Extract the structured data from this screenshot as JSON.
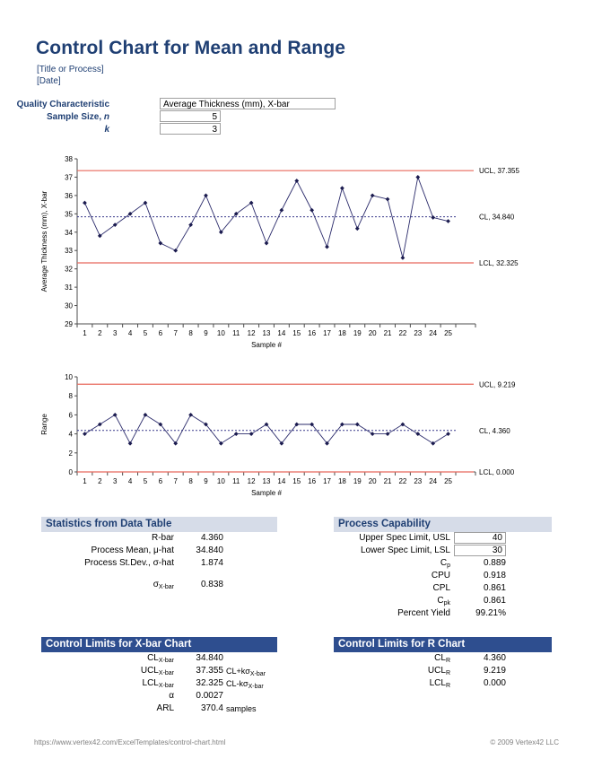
{
  "header": {
    "title": "Control Chart for Mean and Range",
    "subtitle_process": "[Title or Process]",
    "subtitle_date": "[Date]",
    "accent_color": "#1F3F73"
  },
  "inputs": {
    "quality_characteristic_label": "Quality Characteristic",
    "quality_characteristic_value": "Average Thickness (mm), X-bar",
    "sample_size_label": "Sample Size, n",
    "sample_size_value": "5",
    "k_label": "k",
    "k_value": "3"
  },
  "chart_data": [
    {
      "type": "line",
      "name": "xbar-chart",
      "title": "",
      "xlabel": "Sample #",
      "ylabel": "Average Thickness (mm), X-bar",
      "categories": [
        1,
        2,
        3,
        4,
        5,
        6,
        7,
        8,
        9,
        10,
        11,
        12,
        13,
        14,
        15,
        16,
        17,
        18,
        19,
        20,
        21,
        22,
        23,
        24,
        25
      ],
      "values": [
        35.6,
        33.8,
        34.4,
        35.0,
        35.6,
        33.4,
        33.0,
        34.4,
        36.0,
        34.0,
        35.0,
        35.6,
        33.4,
        35.2,
        36.8,
        35.2,
        33.2,
        36.4,
        34.2,
        36.0,
        35.8,
        32.6,
        37.0,
        34.8,
        34.6
      ],
      "ylim": [
        29,
        38
      ],
      "ytick_step": 1,
      "yticks": [
        29,
        30,
        31,
        32,
        33,
        34,
        35,
        36,
        37,
        38
      ],
      "grid": false,
      "legend": "none",
      "reference_lines": [
        {
          "key": "UCL",
          "label": "UCL, 37.355",
          "value": 37.355,
          "color": "#E8685C",
          "style": "solid"
        },
        {
          "key": "CL",
          "label": "CL, 34.840",
          "value": 34.84,
          "color": "#3A3A8C",
          "style": "dashed"
        },
        {
          "key": "LCL",
          "label": "LCL, 32.325",
          "value": 32.325,
          "color": "#E8685C",
          "style": "solid"
        }
      ]
    },
    {
      "type": "line",
      "name": "r-chart",
      "title": "",
      "xlabel": "Sample #",
      "ylabel": "Range",
      "categories": [
        1,
        2,
        3,
        4,
        5,
        6,
        7,
        8,
        9,
        10,
        11,
        12,
        13,
        14,
        15,
        16,
        17,
        18,
        19,
        20,
        21,
        22,
        23,
        24,
        25
      ],
      "values": [
        4,
        5,
        6,
        3,
        6,
        5,
        3,
        6,
        5,
        3,
        4,
        4,
        5,
        3,
        5,
        5,
        3,
        5,
        5,
        4,
        4,
        5,
        4,
        3,
        4
      ],
      "ylim": [
        0,
        10
      ],
      "ytick_step": 2,
      "yticks": [
        0,
        2,
        4,
        6,
        8,
        10
      ],
      "grid": false,
      "legend": "none",
      "reference_lines": [
        {
          "key": "UCL",
          "label": "UCL, 9.219",
          "value": 9.219,
          "color": "#E8685C",
          "style": "solid"
        },
        {
          "key": "CL",
          "label": "CL, 4.360",
          "value": 4.36,
          "color": "#3A3A8C",
          "style": "dashed"
        },
        {
          "key": "LCL",
          "label": "LCL, 0.000",
          "value": 0.0,
          "color": "#E8685C",
          "style": "solid"
        }
      ]
    }
  ],
  "stats_panel": {
    "heading": "Statistics from Data Table",
    "rows": [
      {
        "label": "R-bar",
        "value": "4.360"
      },
      {
        "label": "Process Mean, μ-hat",
        "value": "34.840"
      },
      {
        "label": "Process St.Dev., σ-hat",
        "value": "1.874"
      },
      {
        "label": "σ",
        "label_sub": "X-bar",
        "value": "0.838"
      }
    ]
  },
  "capability_panel": {
    "heading": "Process Capability",
    "rows": [
      {
        "label": "Upper Spec Limit, USL",
        "value": "40",
        "boxed": true
      },
      {
        "label": "Lower Spec Limit, LSL",
        "value": "30",
        "boxed": true
      },
      {
        "label": "C",
        "label_sub": "p",
        "value": "0.889"
      },
      {
        "label": "CPU",
        "value": "0.918"
      },
      {
        "label": "CPL",
        "value": "0.861"
      },
      {
        "label": "C",
        "label_sub": "pk",
        "value": "0.861"
      },
      {
        "label": "Percent Yield",
        "value": "99.21%"
      }
    ]
  },
  "xbar_limits_panel": {
    "heading": "Control Limits for X-bar Chart",
    "rows": [
      {
        "label": "CL",
        "label_sub": "X-bar",
        "value": "34.840",
        "note": ""
      },
      {
        "label": "UCL",
        "label_sub": "X-bar",
        "value": "37.355",
        "note": "CL+kσ",
        "note_sub": "X-bar"
      },
      {
        "label": "LCL",
        "label_sub": "X-bar",
        "value": "32.325",
        "note": "CL-kσ",
        "note_sub": "X-bar"
      },
      {
        "label": "α",
        "value": "0.0027",
        "note": ""
      },
      {
        "label": "ARL",
        "value": "370.4",
        "note": "samples"
      }
    ]
  },
  "r_limits_panel": {
    "heading": "Control Limits for R Chart",
    "rows": [
      {
        "label": "CL",
        "label_sub": "R",
        "value": "4.360"
      },
      {
        "label": "UCL",
        "label_sub": "R",
        "value": "9.219"
      },
      {
        "label": "LCL",
        "label_sub": "R",
        "value": "0.000"
      }
    ]
  },
  "footer": {
    "url": "https://www.vertex42.com/ExcelTemplates/control-chart.html",
    "copyright": "© 2009 Vertex42 LLC"
  }
}
